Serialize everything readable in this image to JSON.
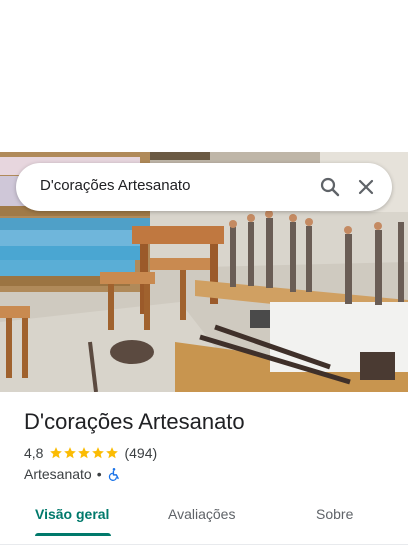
{
  "search": {
    "query": "D'corações Artesanato"
  },
  "place": {
    "name": "D'corações Artesanato",
    "rating": "4,8",
    "stars": 5,
    "review_count": "(494)",
    "category": "Artesanato",
    "separator": "•"
  },
  "tabs": [
    {
      "label": "Visão geral",
      "active": true
    },
    {
      "label": "Avaliações",
      "active": false
    },
    {
      "label": "Sobre",
      "active": false
    }
  ],
  "colors": {
    "accent": "#00796b",
    "star": "#fbbc04",
    "accessibility": "#1a73e8"
  },
  "icons": {
    "search": "search-icon",
    "close": "close-icon",
    "star": "star-icon",
    "accessibility": "wheelchair-icon"
  }
}
